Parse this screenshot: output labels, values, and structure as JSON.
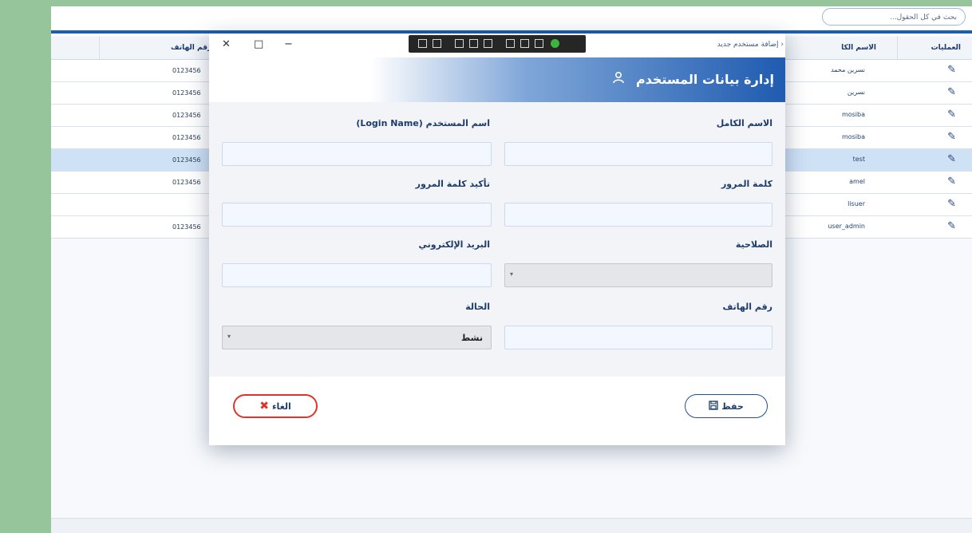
{
  "search": {
    "placeholder": "بحث في كل الحقول..."
  },
  "grid": {
    "columns": {
      "operations": "العمليات",
      "full_name": "الاسم الكا",
      "phone": "رقم الهاتف"
    },
    "rows": [
      {
        "name": "نسرين محمد",
        "phone": "0123456",
        "selected": false
      },
      {
        "name": "نسرين",
        "phone": "0123456",
        "selected": false
      },
      {
        "name": "mosiba",
        "phone": "0123456",
        "selected": false
      },
      {
        "name": "mosiba",
        "phone": "0123456",
        "selected": false
      },
      {
        "name": "test",
        "phone": "0123456",
        "selected": true
      },
      {
        "name": "amel",
        "phone": "0123456",
        "selected": false
      },
      {
        "name": "lisuer",
        "phone": "",
        "selected": false
      },
      {
        "name": "user_admin",
        "phone": "0123456",
        "selected": false
      }
    ]
  },
  "window": {
    "breadcrumb": "إضافة مستخدم جديد",
    "title": "إدارة بيانات المستخدم"
  },
  "form": {
    "full_name_label": "الاسم الكامل",
    "username_label": "اسم المستخدم (Login Name)",
    "password_label": "كلمة المرور",
    "confirm_password_label": "تأكيد كلمة المرور",
    "role_label": "الصلاحية",
    "email_label": "البريد الإلكتروني",
    "phone_label": "رقم الهاتف",
    "status_label": "الحالة",
    "status_value": "نشط"
  },
  "buttons": {
    "save": "حفظ",
    "cancel": "الغاء"
  },
  "colors": {
    "primary": "#1f5bb0",
    "danger": "#e0342b",
    "page_bg": "#96c59b"
  }
}
